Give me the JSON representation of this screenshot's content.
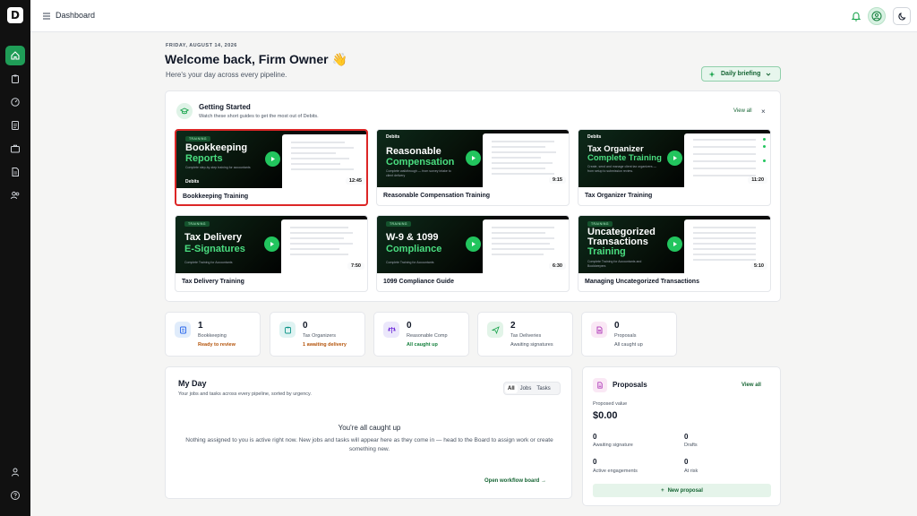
{
  "app": {
    "logo_letter": "D"
  },
  "topbar": {
    "title": "Dashboard"
  },
  "header": {
    "date": "FRIDAY, AUGUST 14, 2026",
    "welcome": "Welcome back, Firm Owner 👋",
    "subtitle": "Here's your day across every pipeline.",
    "briefing_label": "Daily briefing"
  },
  "getting_started": {
    "title": "Getting Started",
    "subtitle": "Watch these short guides to get the most out of Debits.",
    "view_all": "View all",
    "close": "×",
    "videos": [
      {
        "label": "Bookkeeping Training",
        "duration": "12:45",
        "thumb_title": "Bookkeeping",
        "thumb_title2": "Reports",
        "thumb_desc": "Complete step-by-step training for accountants",
        "badge": "TRAINING",
        "brand": "Debits"
      },
      {
        "label": "Reasonable Compensation Training",
        "duration": "9:15",
        "thumb_title": "Reasonable",
        "thumb_title2": "Compensation",
        "thumb_desc": "Complete walkthrough — from survey intake to client delivery",
        "brand": "Debits"
      },
      {
        "label": "Tax Organizer Training",
        "duration": "11:20",
        "thumb_title": "Tax Organizer",
        "thumb_title2": "Complete Training",
        "thumb_desc": "Create, send and manage client tax organizers — from setup to submission review.",
        "brand": "Debits"
      },
      {
        "label": "Tax Delivery Training",
        "duration": "7:50",
        "thumb_title": "Tax Delivery",
        "thumb_title2": "E-Signatures",
        "thumb_desc": "Complete Training for Accountants",
        "badge": "TRAINING"
      },
      {
        "label": "1099 Compliance Guide",
        "duration": "6:30",
        "thumb_title": "W-9 & 1099",
        "thumb_title2": "Compliance",
        "thumb_desc": "Complete Training for Accountants",
        "badge": "TRAINING"
      },
      {
        "label": "Managing Uncategorized Transactions",
        "duration": "5:10",
        "thumb_title": "Uncategorized",
        "thumb_title1b": "Transactions",
        "thumb_title2": "Training",
        "thumb_desc": "Complete Training for Accountants and Bookkeepers",
        "badge": "TRAINING"
      }
    ]
  },
  "stats": [
    {
      "count": "1",
      "label": "Bookkeeping",
      "status": "Ready to review",
      "status_color": "#b45309",
      "icon": "book-icon"
    },
    {
      "count": "0",
      "label": "Tax Organizers",
      "status": "1 awaiting delivery",
      "status_color": "#b45309",
      "icon": "clipboard-icon"
    },
    {
      "count": "0",
      "label": "Reasonable Comp",
      "status": "All caught up",
      "status_color": "#15803d",
      "icon": "scale-icon"
    },
    {
      "count": "2",
      "label": "Tax Deliveries",
      "status": "Awaiting signatures",
      "status_color": "#4b5563",
      "icon": "send-icon"
    },
    {
      "count": "0",
      "label": "Proposals",
      "status": "All caught up",
      "status_color": "#4b5563",
      "icon": "document-icon"
    }
  ],
  "my_day": {
    "title": "My Day",
    "subtitle": "Your jobs and tasks across every pipeline, sorted by urgency.",
    "tabs": [
      "All",
      "Jobs",
      "Tasks"
    ],
    "empty_title": "You're all caught up",
    "empty_text": "Nothing assigned to you is active right now. New jobs and tasks will appear here as they come in — head to the Board to assign work or create something new.",
    "open_board": "Open workflow board →"
  },
  "proposals": {
    "title": "Proposals",
    "view_all": "View all",
    "value_label": "Proposed value",
    "value": "$0.00",
    "awaiting_count": "0",
    "awaiting_label": "Awaiting signature",
    "drafts_count": "0",
    "drafts_label": "Drafts",
    "active_count": "0",
    "active_label": "Active engagements",
    "risk_count": "0",
    "risk_label": "At risk",
    "new_label": "New proposal"
  },
  "colors": {
    "accent": "#22c55e",
    "sidebar": "#111111",
    "active_nav": "#1f9d57"
  }
}
